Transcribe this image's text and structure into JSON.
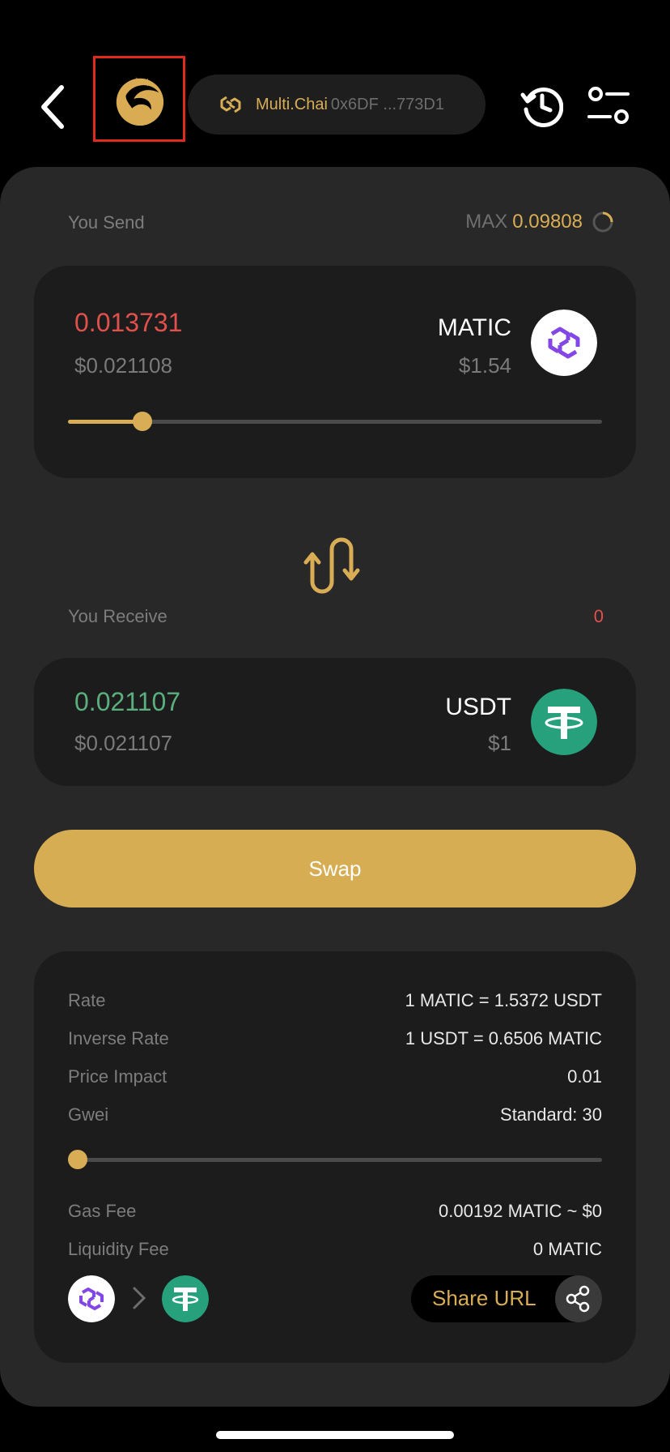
{
  "header": {
    "chain_name": "Multi.Chai",
    "chain_address": "0x6DF ...773D1"
  },
  "send": {
    "label": "You Send",
    "max_label": "MAX",
    "max_value": "0.09808",
    "amount": "0.013731",
    "fiat": "$0.021108",
    "token_symbol": "MATIC",
    "token_price": "$1.54",
    "slider_fraction": 0.14
  },
  "receive": {
    "label": "You Receive",
    "zero_value": "0",
    "amount": "0.021107",
    "fiat": "$0.021107",
    "token_symbol": "USDT",
    "token_price": "$1"
  },
  "swap_label": "Swap",
  "details": {
    "rows": [
      {
        "key": "Rate",
        "value": "1 MATIC = 1.5372 USDT"
      },
      {
        "key": "Inverse Rate",
        "value": "1 USDT = 0.6506 MATIC"
      },
      {
        "key": "Price Impact",
        "value": "0.01"
      },
      {
        "key": "Gwei",
        "value": "Standard: 30"
      }
    ],
    "gwei_slider_fraction": 0.0,
    "fee_rows": [
      {
        "key": "Gas Fee",
        "value": "0.00192 MATIC ~ $0"
      },
      {
        "key": "Liquidity Fee",
        "value": "0 MATIC"
      }
    ],
    "share_label": "Share URL"
  },
  "colors": {
    "accent": "#d8ad55",
    "matic": "#8247e5",
    "tether": "#26a17b",
    "negative": "#e0504c",
    "positive": "#5bae7e"
  },
  "icons": {
    "back": "chevron-left-icon",
    "logo": "dragon-logo-icon",
    "chain": "chain-link-icon",
    "history": "history-icon",
    "settings": "sliders-icon",
    "swap": "swap-arrows-icon",
    "share": "share-icon"
  }
}
